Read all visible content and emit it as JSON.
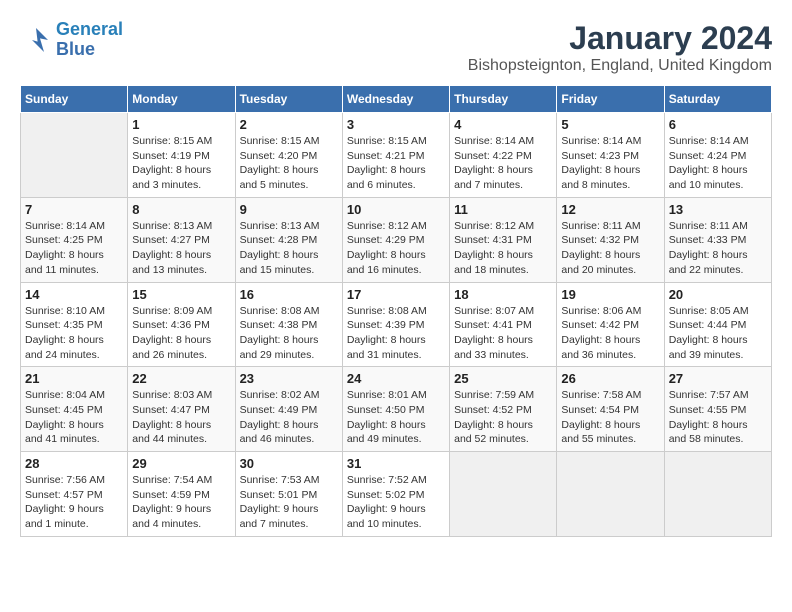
{
  "logo": {
    "line1": "General",
    "line2": "Blue"
  },
  "title": "January 2024",
  "location": "Bishopsteignton, England, United Kingdom",
  "days_of_week": [
    "Sunday",
    "Monday",
    "Tuesday",
    "Wednesday",
    "Thursday",
    "Friday",
    "Saturday"
  ],
  "weeks": [
    [
      {
        "day": "",
        "sunrise": "",
        "sunset": "",
        "daylight": ""
      },
      {
        "day": "1",
        "sunrise": "Sunrise: 8:15 AM",
        "sunset": "Sunset: 4:19 PM",
        "daylight": "Daylight: 8 hours and 3 minutes."
      },
      {
        "day": "2",
        "sunrise": "Sunrise: 8:15 AM",
        "sunset": "Sunset: 4:20 PM",
        "daylight": "Daylight: 8 hours and 5 minutes."
      },
      {
        "day": "3",
        "sunrise": "Sunrise: 8:15 AM",
        "sunset": "Sunset: 4:21 PM",
        "daylight": "Daylight: 8 hours and 6 minutes."
      },
      {
        "day": "4",
        "sunrise": "Sunrise: 8:14 AM",
        "sunset": "Sunset: 4:22 PM",
        "daylight": "Daylight: 8 hours and 7 minutes."
      },
      {
        "day": "5",
        "sunrise": "Sunrise: 8:14 AM",
        "sunset": "Sunset: 4:23 PM",
        "daylight": "Daylight: 8 hours and 8 minutes."
      },
      {
        "day": "6",
        "sunrise": "Sunrise: 8:14 AM",
        "sunset": "Sunset: 4:24 PM",
        "daylight": "Daylight: 8 hours and 10 minutes."
      }
    ],
    [
      {
        "day": "7",
        "sunrise": "Sunrise: 8:14 AM",
        "sunset": "Sunset: 4:25 PM",
        "daylight": "Daylight: 8 hours and 11 minutes."
      },
      {
        "day": "8",
        "sunrise": "Sunrise: 8:13 AM",
        "sunset": "Sunset: 4:27 PM",
        "daylight": "Daylight: 8 hours and 13 minutes."
      },
      {
        "day": "9",
        "sunrise": "Sunrise: 8:13 AM",
        "sunset": "Sunset: 4:28 PM",
        "daylight": "Daylight: 8 hours and 15 minutes."
      },
      {
        "day": "10",
        "sunrise": "Sunrise: 8:12 AM",
        "sunset": "Sunset: 4:29 PM",
        "daylight": "Daylight: 8 hours and 16 minutes."
      },
      {
        "day": "11",
        "sunrise": "Sunrise: 8:12 AM",
        "sunset": "Sunset: 4:31 PM",
        "daylight": "Daylight: 8 hours and 18 minutes."
      },
      {
        "day": "12",
        "sunrise": "Sunrise: 8:11 AM",
        "sunset": "Sunset: 4:32 PM",
        "daylight": "Daylight: 8 hours and 20 minutes."
      },
      {
        "day": "13",
        "sunrise": "Sunrise: 8:11 AM",
        "sunset": "Sunset: 4:33 PM",
        "daylight": "Daylight: 8 hours and 22 minutes."
      }
    ],
    [
      {
        "day": "14",
        "sunrise": "Sunrise: 8:10 AM",
        "sunset": "Sunset: 4:35 PM",
        "daylight": "Daylight: 8 hours and 24 minutes."
      },
      {
        "day": "15",
        "sunrise": "Sunrise: 8:09 AM",
        "sunset": "Sunset: 4:36 PM",
        "daylight": "Daylight: 8 hours and 26 minutes."
      },
      {
        "day": "16",
        "sunrise": "Sunrise: 8:08 AM",
        "sunset": "Sunset: 4:38 PM",
        "daylight": "Daylight: 8 hours and 29 minutes."
      },
      {
        "day": "17",
        "sunrise": "Sunrise: 8:08 AM",
        "sunset": "Sunset: 4:39 PM",
        "daylight": "Daylight: 8 hours and 31 minutes."
      },
      {
        "day": "18",
        "sunrise": "Sunrise: 8:07 AM",
        "sunset": "Sunset: 4:41 PM",
        "daylight": "Daylight: 8 hours and 33 minutes."
      },
      {
        "day": "19",
        "sunrise": "Sunrise: 8:06 AM",
        "sunset": "Sunset: 4:42 PM",
        "daylight": "Daylight: 8 hours and 36 minutes."
      },
      {
        "day": "20",
        "sunrise": "Sunrise: 8:05 AM",
        "sunset": "Sunset: 4:44 PM",
        "daylight": "Daylight: 8 hours and 39 minutes."
      }
    ],
    [
      {
        "day": "21",
        "sunrise": "Sunrise: 8:04 AM",
        "sunset": "Sunset: 4:45 PM",
        "daylight": "Daylight: 8 hours and 41 minutes."
      },
      {
        "day": "22",
        "sunrise": "Sunrise: 8:03 AM",
        "sunset": "Sunset: 4:47 PM",
        "daylight": "Daylight: 8 hours and 44 minutes."
      },
      {
        "day": "23",
        "sunrise": "Sunrise: 8:02 AM",
        "sunset": "Sunset: 4:49 PM",
        "daylight": "Daylight: 8 hours and 46 minutes."
      },
      {
        "day": "24",
        "sunrise": "Sunrise: 8:01 AM",
        "sunset": "Sunset: 4:50 PM",
        "daylight": "Daylight: 8 hours and 49 minutes."
      },
      {
        "day": "25",
        "sunrise": "Sunrise: 7:59 AM",
        "sunset": "Sunset: 4:52 PM",
        "daylight": "Daylight: 8 hours and 52 minutes."
      },
      {
        "day": "26",
        "sunrise": "Sunrise: 7:58 AM",
        "sunset": "Sunset: 4:54 PM",
        "daylight": "Daylight: 8 hours and 55 minutes."
      },
      {
        "day": "27",
        "sunrise": "Sunrise: 7:57 AM",
        "sunset": "Sunset: 4:55 PM",
        "daylight": "Daylight: 8 hours and 58 minutes."
      }
    ],
    [
      {
        "day": "28",
        "sunrise": "Sunrise: 7:56 AM",
        "sunset": "Sunset: 4:57 PM",
        "daylight": "Daylight: 9 hours and 1 minute."
      },
      {
        "day": "29",
        "sunrise": "Sunrise: 7:54 AM",
        "sunset": "Sunset: 4:59 PM",
        "daylight": "Daylight: 9 hours and 4 minutes."
      },
      {
        "day": "30",
        "sunrise": "Sunrise: 7:53 AM",
        "sunset": "Sunset: 5:01 PM",
        "daylight": "Daylight: 9 hours and 7 minutes."
      },
      {
        "day": "31",
        "sunrise": "Sunrise: 7:52 AM",
        "sunset": "Sunset: 5:02 PM",
        "daylight": "Daylight: 9 hours and 10 minutes."
      },
      {
        "day": "",
        "sunrise": "",
        "sunset": "",
        "daylight": ""
      },
      {
        "day": "",
        "sunrise": "",
        "sunset": "",
        "daylight": ""
      },
      {
        "day": "",
        "sunrise": "",
        "sunset": "",
        "daylight": ""
      }
    ]
  ]
}
